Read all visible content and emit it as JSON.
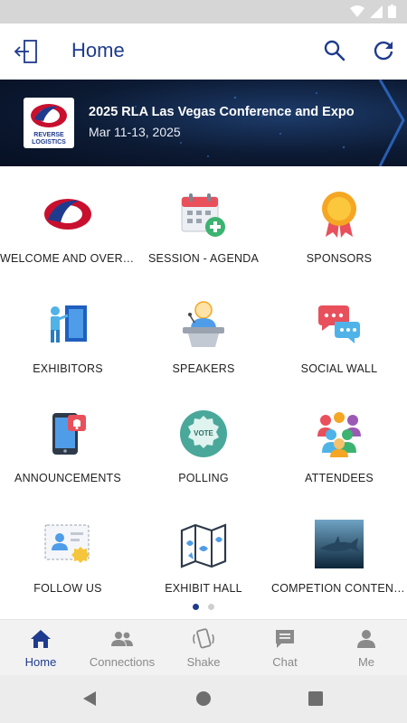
{
  "header": {
    "title": "Home"
  },
  "banner": {
    "event_title": "2025 RLA Las Vegas Conference and Expo",
    "event_dates": "Mar 11-13, 2025",
    "logo_text_line1": "REVERSE",
    "logo_text_line2": "LOGISTICS"
  },
  "tiles": [
    {
      "label": "WELCOME AND OVERVI...",
      "icon": "rla-logo-icon"
    },
    {
      "label": "SESSION - AGENDA",
      "icon": "calendar-add-icon"
    },
    {
      "label": "SPONSORS",
      "icon": "award-ribbon-icon"
    },
    {
      "label": "EXHIBITORS",
      "icon": "exhibitor-booth-icon"
    },
    {
      "label": "SPEAKERS",
      "icon": "speaker-podium-icon"
    },
    {
      "label": "SOCIAL WALL",
      "icon": "chat-bubbles-icon"
    },
    {
      "label": "ANNOUNCEMENTS",
      "icon": "phone-notification-icon"
    },
    {
      "label": "POLLING",
      "icon": "vote-badge-icon"
    },
    {
      "label": "ATTENDEES",
      "icon": "people-group-icon"
    },
    {
      "label": "FOLLOW US",
      "icon": "certificate-icon"
    },
    {
      "label": "EXHIBIT HALL",
      "icon": "floor-map-icon"
    },
    {
      "label": "COMPETION CONTEND...",
      "icon": "shark-photo-icon"
    }
  ],
  "pager": {
    "pages": 2,
    "active": 1
  },
  "tabs": [
    {
      "label": "Home",
      "icon": "home-icon",
      "active": true
    },
    {
      "label": "Connections",
      "icon": "people-icon",
      "active": false
    },
    {
      "label": "Shake",
      "icon": "shake-phone-icon",
      "active": false
    },
    {
      "label": "Chat",
      "icon": "chat-icon",
      "active": false
    },
    {
      "label": "Me",
      "icon": "person-icon",
      "active": false
    }
  ],
  "colors": {
    "primary": "#1f3b8e",
    "inactive": "#8a8a8a"
  }
}
